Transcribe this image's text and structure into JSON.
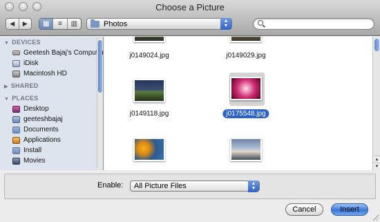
{
  "window": {
    "title": "Choose a Picture"
  },
  "toolbar": {
    "back": "◀",
    "forward": "▶",
    "path": "Photos",
    "search_placeholder": ""
  },
  "sidebar": {
    "sections": [
      {
        "label": "DEVICES",
        "items": [
          {
            "label": "Geetesh Bajaj’s Computer",
            "icon": "computer-icon"
          },
          {
            "label": "iDisk",
            "icon": "idisk-icon"
          },
          {
            "label": "Macintosh HD",
            "icon": "hard-drive-icon"
          }
        ]
      },
      {
        "label": "SHARED",
        "items": []
      },
      {
        "label": "PLACES",
        "items": [
          {
            "label": "Desktop",
            "icon": "desktop-icon"
          },
          {
            "label": "geeteshbajaj",
            "icon": "home-icon"
          },
          {
            "label": "Documents",
            "icon": "folder-icon"
          },
          {
            "label": "Applications",
            "icon": "applications-icon"
          },
          {
            "label": "Install",
            "icon": "folder-icon"
          },
          {
            "label": "Movies",
            "icon": "movies-icon"
          }
        ]
      }
    ]
  },
  "files": [
    {
      "name": "j0149024.jpg",
      "selected": false
    },
    {
      "name": "j0149029.jpg",
      "selected": false
    },
    {
      "name": "j0149118.jpg",
      "selected": false
    },
    {
      "name": "j0175548.jpg",
      "selected": true
    }
  ],
  "enable": {
    "label": "Enable:",
    "value": "All Picture Files"
  },
  "buttons": {
    "cancel": "Cancel",
    "insert": "Insert"
  }
}
